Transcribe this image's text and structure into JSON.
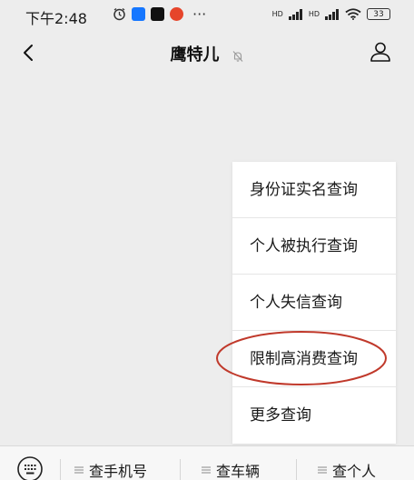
{
  "status_bar": {
    "time": "下午2:48",
    "battery": "33",
    "signal_label_1": "HD",
    "signal_label_2": "HD"
  },
  "nav": {
    "title": "鹰特儿"
  },
  "menu": {
    "items": [
      {
        "label": "身份证实名查询"
      },
      {
        "label": "个人被执行查询"
      },
      {
        "label": "个人失信查询"
      },
      {
        "label": "限制高消费查询"
      },
      {
        "label": "更多查询"
      }
    ],
    "highlighted_index": 3
  },
  "bottom_bar": {
    "items": [
      {
        "label": "查手机号"
      },
      {
        "label": "查车辆"
      },
      {
        "label": "查个人"
      }
    ]
  },
  "colors": {
    "background": "#ededed",
    "menu_bg": "#ffffff",
    "highlight_circle": "#c0392b"
  }
}
